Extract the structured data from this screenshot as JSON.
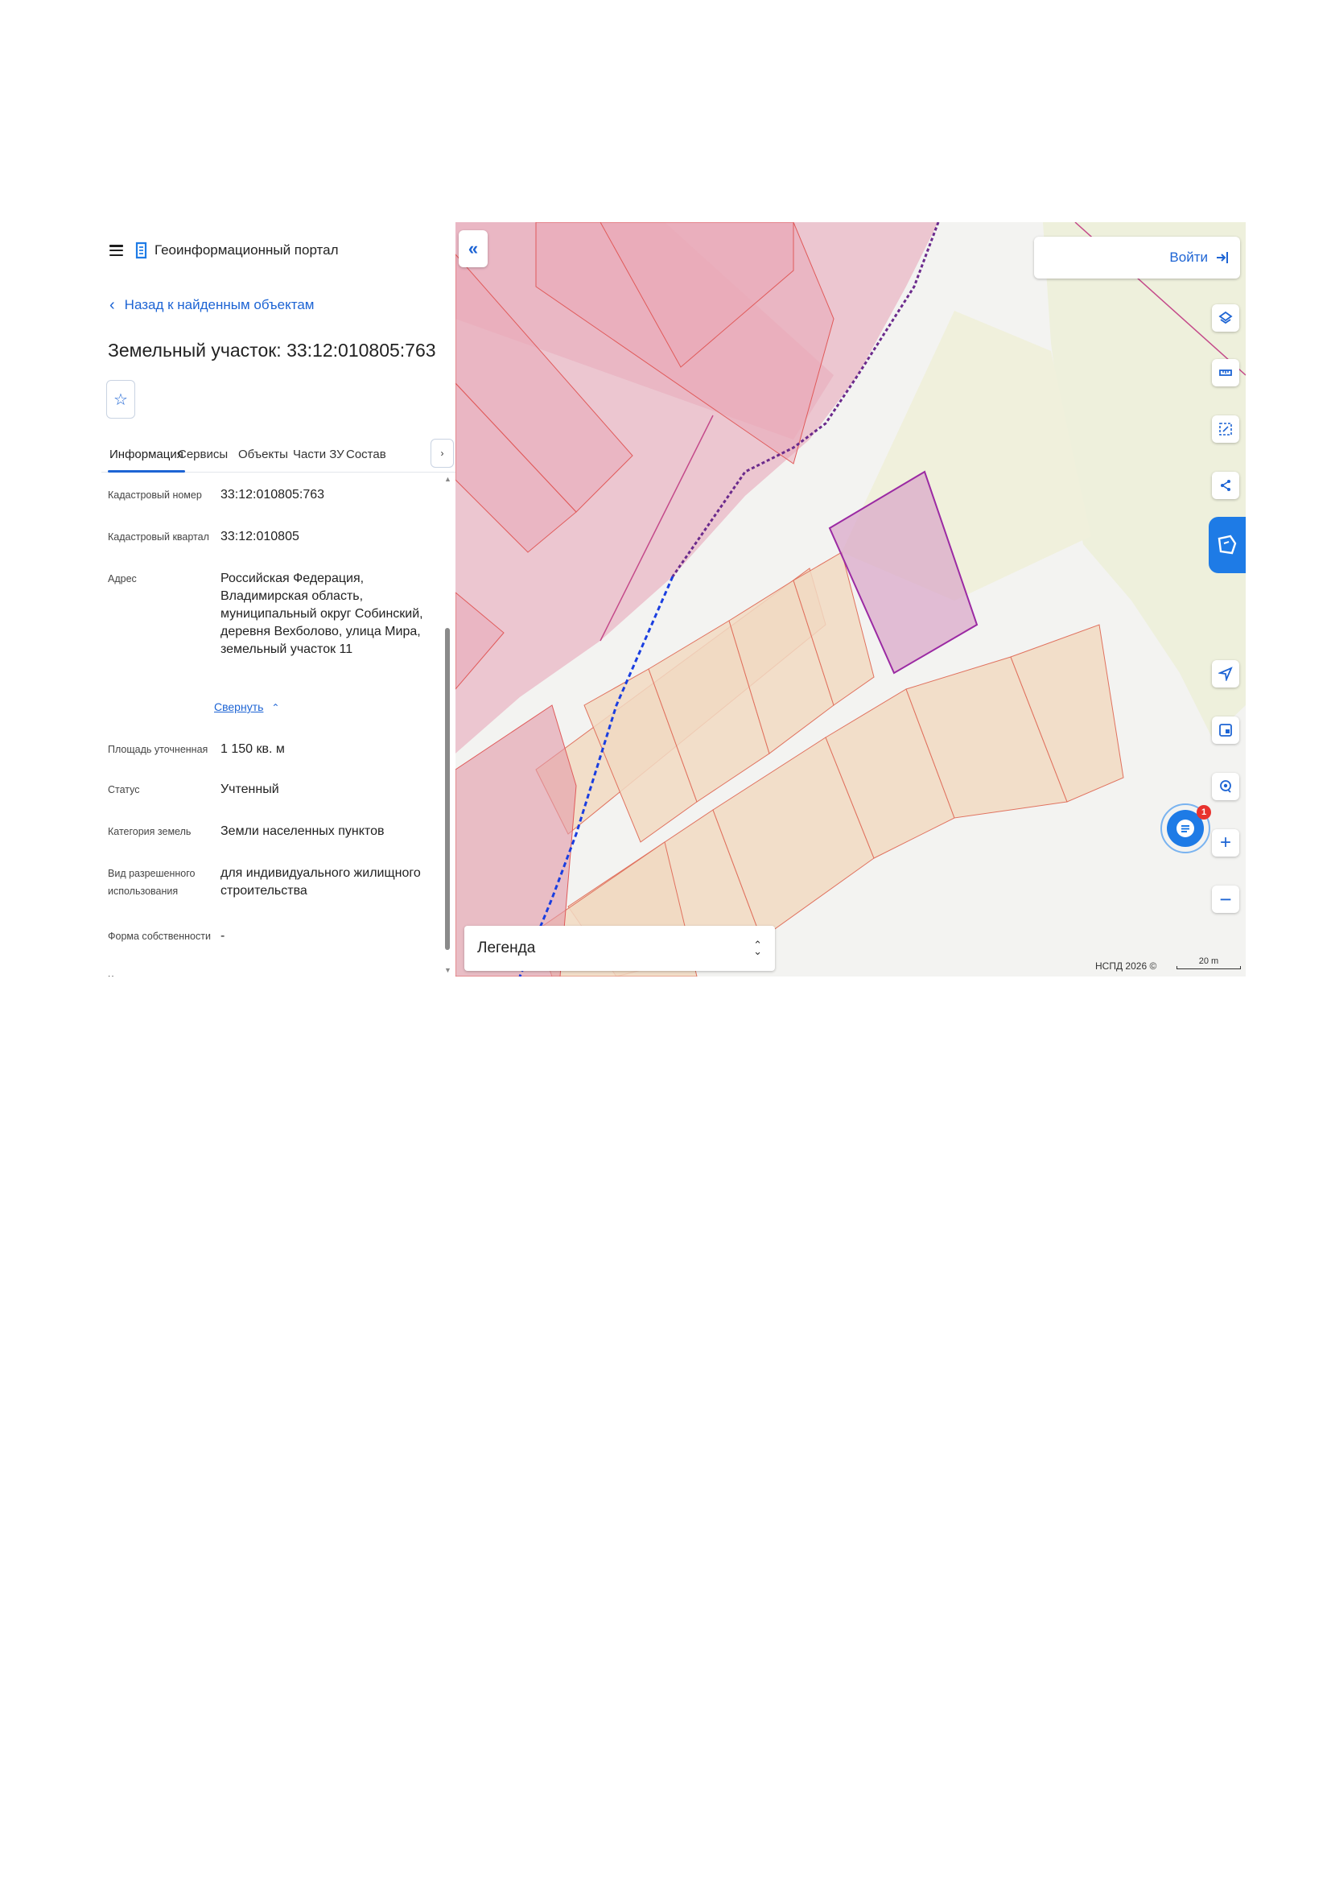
{
  "header": {
    "brand": "Геоинформационный портал"
  },
  "back_link": "Назад к найденным объектам",
  "title": "Земельный участок: 33:12:010805:763",
  "tabs": [
    "Информация",
    "Сервисы",
    "Объекты",
    "Части ЗУ",
    "Состав"
  ],
  "details": [
    {
      "key": "Кадастровый номер",
      "value": "33:12:010805:763"
    },
    {
      "key": "Кадастровый квартал",
      "value": "33:12:010805"
    },
    {
      "key": "Адрес",
      "value_lines": [
        "Российская Федерация,",
        "Владимирская область,",
        "муниципальный округ Собинский,",
        "деревня Вехболово, улица Мира,",
        "земельный участок 11"
      ]
    },
    {
      "key": "Площадь уточненная",
      "value": "1 150 кв. м"
    },
    {
      "key": "Статус",
      "value": "Учтенный"
    },
    {
      "key": "Категория земель",
      "value": "Земли населенных пунктов"
    },
    {
      "key_lines": [
        "Вид разрешенного",
        "использования"
      ],
      "value_lines": [
        "для индивидуального жилищного",
        "строительства"
      ]
    },
    {
      "key": "Форма собственности",
      "value": "-"
    },
    {
      "key": "Кадастровая",
      "value": "-"
    }
  ],
  "collapse_link": "Свернуть",
  "map": {
    "login_label": "Войти",
    "legend_label": "Легенда",
    "chat_badge": "1",
    "copyright": "НСПД 2026 ©",
    "scale_label": "20 m",
    "colors": {
      "accent": "#1d64d4",
      "parcel_pink": "#e9aab8",
      "parcel_orange": "#f1d9c2",
      "selected_parcel": "#9b2aa3",
      "boundary_blue": "#1a3ee0",
      "boundary_purple": "#6b2a8c"
    },
    "icons": [
      "layers-icon",
      "ruler-icon",
      "select-area-icon",
      "share-icon",
      "geolocation-icon",
      "minimap-icon",
      "pin-search-icon",
      "zoom-in-icon",
      "zoom-out-icon",
      "chat-icon",
      "double-chevron-left-icon",
      "login-icon"
    ]
  }
}
